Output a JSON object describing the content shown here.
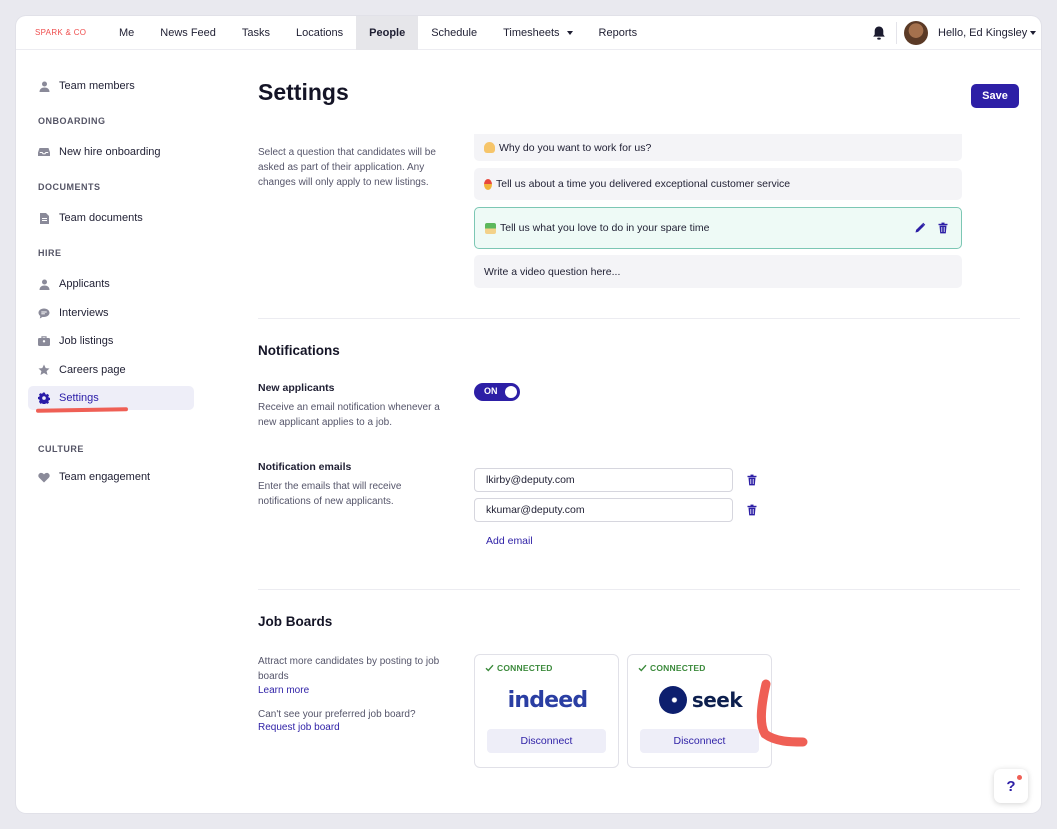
{
  "topnav": {
    "brand": "SPARK & CO",
    "items": [
      {
        "label": "Me"
      },
      {
        "label": "News Feed"
      },
      {
        "label": "Tasks"
      },
      {
        "label": "Locations"
      },
      {
        "label": "People",
        "active": true
      },
      {
        "label": "Schedule"
      },
      {
        "label": "Timesheets",
        "dropdown": true
      },
      {
        "label": "Reports"
      }
    ],
    "greeting": "Hello, Ed Kingsley"
  },
  "sidebar": {
    "team_members": "Team members",
    "onboarding_head": "ONBOARDING",
    "new_hire_onboarding": "New hire onboarding",
    "documents_head": "DOCUMENTS",
    "team_documents": "Team documents",
    "hire_head": "HIRE",
    "applicants": "Applicants",
    "interviews": "Interviews",
    "job_listings": "Job listings",
    "careers_page": "Careers page",
    "settings": "Settings",
    "culture_head": "CULTURE",
    "team_engagement": "Team engagement"
  },
  "page": {
    "title": "Settings",
    "save_label": "Save"
  },
  "questions": {
    "description": "Select a question that candidates will be asked as part of their application. Any changes will only apply to new listings.",
    "items": [
      {
        "text": "Why do you want to work for us?"
      },
      {
        "text": "Tell us about a time you delivered exceptional customer service"
      },
      {
        "text": "Tell us what you love to do in your spare time",
        "selected": true
      }
    ],
    "placeholder": "Write a video question here..."
  },
  "notifications": {
    "title": "Notifications",
    "new_applicants_label": "New applicants",
    "new_applicants_desc": "Receive an email notification whenever a new applicant applies to a job.",
    "toggle_label": "ON",
    "emails_label": "Notification emails",
    "emails_desc": "Enter the emails that will receive notifications of new applicants.",
    "emails": [
      "lkirby@deputy.com",
      "kkumar@deputy.com"
    ],
    "add_email": "Add email"
  },
  "job_boards": {
    "title": "Job Boards",
    "desc": "Attract more candidates by posting to job boards",
    "learn_more": "Learn more",
    "cant_see": "Can't see your preferred job board?",
    "request": "Request job board",
    "boards": [
      {
        "name": "indeed",
        "status": "CONNECTED",
        "action": "Disconnect"
      },
      {
        "name": "seek",
        "status": "CONNECTED",
        "action": "Disconnect"
      }
    ]
  },
  "help": {
    "label": "?"
  },
  "colors": {
    "accent": "#2d1fa6",
    "brand": "#ef4e4e",
    "connected": "#3c8a3c",
    "selected_border": "#7cc7b4"
  }
}
